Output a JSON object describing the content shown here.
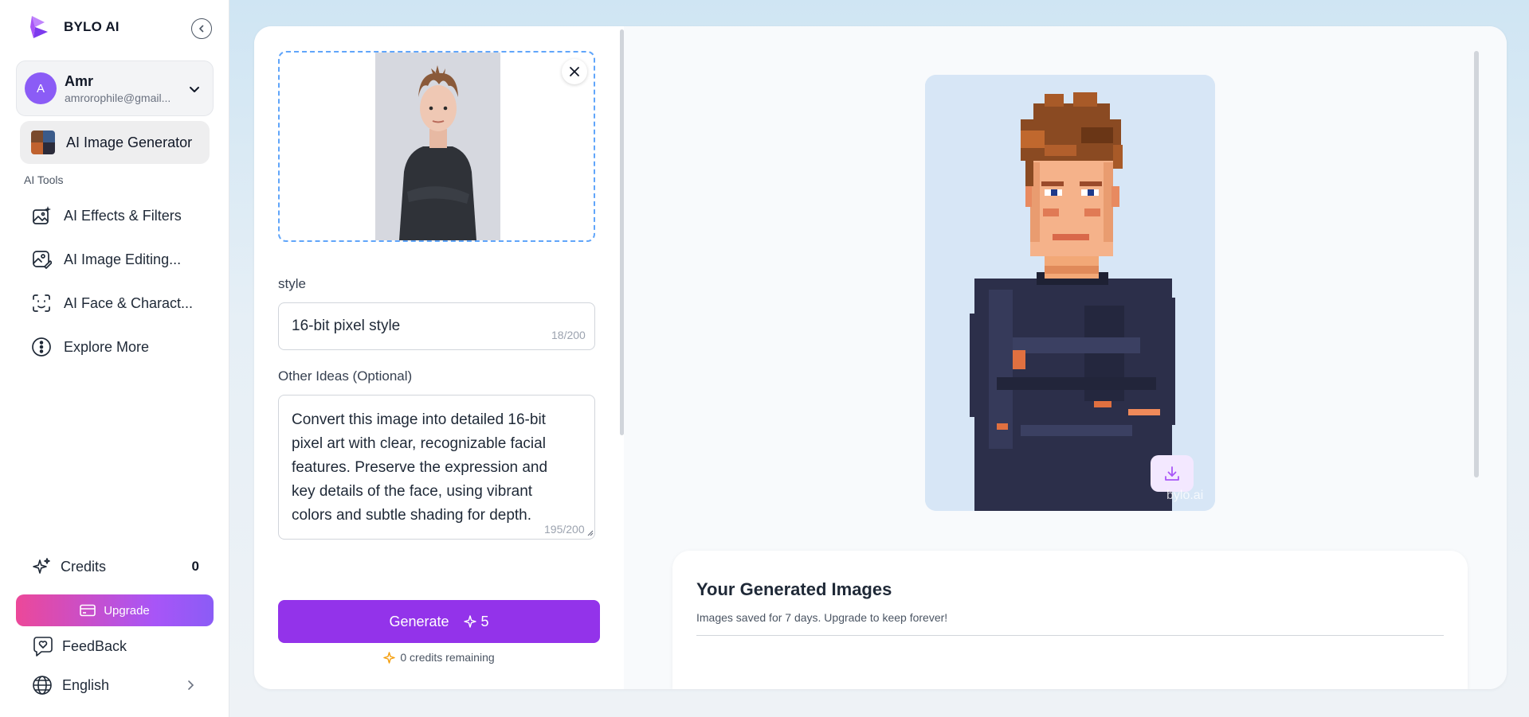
{
  "brand": {
    "name": "BYLO AI",
    "logo_icon": "bylo-logo-icon"
  },
  "account": {
    "avatar_initial": "A",
    "name": "Amr",
    "email": "amrorophile@gmail..."
  },
  "nav": {
    "active": {
      "label": "AI Image Generator"
    },
    "section_label": "AI Tools",
    "items": [
      {
        "label": "AI Effects & Filters",
        "icon": "image-sparkle-icon"
      },
      {
        "label": "AI Image Editing...",
        "icon": "image-edit-icon"
      },
      {
        "label": "AI Face & Charact...",
        "icon": "face-scan-icon"
      },
      {
        "label": "Explore More",
        "icon": "more-dots-icon"
      }
    ]
  },
  "credits": {
    "label": "Credits",
    "value": "0"
  },
  "upgrade": {
    "label": "Upgrade"
  },
  "feedback": {
    "label": "FeedBack"
  },
  "language": {
    "label": "English"
  },
  "form": {
    "style_label": "style",
    "style_value": "16-bit pixel style",
    "style_counter": "18/200",
    "ideas_label": "Other Ideas (Optional)",
    "ideas_value": "Convert this image into detailed 16-bit pixel art with clear, recognizable facial features. Preserve the expression and key details of the face, using vibrant colors and subtle shading for depth.",
    "ideas_counter": "195/200",
    "generate_label": "Generate",
    "generate_cost": "5",
    "remaining": "0 credits remaining"
  },
  "result": {
    "watermark": "bylo.ai"
  },
  "gallery": {
    "title": "Your Generated Images",
    "subtitle": "Images saved for 7 days. Upgrade to keep forever!"
  },
  "colors": {
    "accent": "#9333ea",
    "upgrade_start": "#ec4899",
    "upgrade_end": "#8b5cf6",
    "dashed_border": "#60a5fa"
  }
}
